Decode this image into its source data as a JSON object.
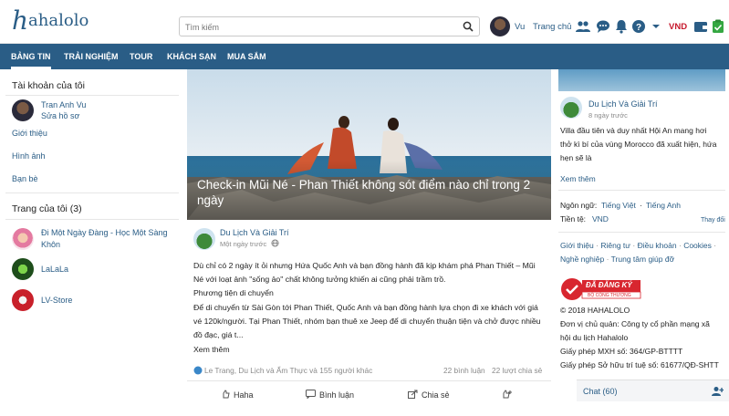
{
  "header": {
    "logo_h": "h",
    "logo_rest": "ahalolo",
    "search_placeholder": "Tìm kiếm",
    "user_name": "Vu",
    "home_label": "Trang chủ",
    "currency": "VND",
    "icons": [
      "search-icon",
      "friends-icon",
      "messages-icon",
      "notifications-icon",
      "help-icon",
      "chevron-down-icon",
      "wallet-icon",
      "clipboard-icon"
    ]
  },
  "nav": {
    "items": [
      "BẢNG TIN",
      "TRẢI NGHIỆM",
      "TOUR",
      "KHÁCH SẠN",
      "MUA SẮM"
    ],
    "active_index": 0
  },
  "left": {
    "account_title": "Tài khoản của tôi",
    "user_name": "Tran Anh Vu",
    "edit_profile": "Sửa hồ sơ",
    "links": [
      "Giới thiệu",
      "Hình ảnh",
      "Bạn bè"
    ],
    "pages_title": "Trang của tôi (3)",
    "pages": [
      {
        "name_line1": "Đi Một Ngày Đàng - Học Một Sàng",
        "name_line2": "Khôn"
      },
      {
        "name_line1": "LaLaLa",
        "name_line2": ""
      },
      {
        "name_line1": "LV-Store",
        "name_line2": ""
      }
    ]
  },
  "feed": {
    "hero_title": "Check-in Mũi Né - Phan Thiết không sót điểm nào chỉ trong 2 ngày",
    "author": "Du Lịch Và Giải Trí",
    "time": "Một ngày trước",
    "text_lines": [
      "Dù chỉ có 2 ngày ít ỏi nhưng Hứa Quốc Anh và bạn đồng hành đã kịp khám phá Phan Thiết – Mũi",
      "Né với loạt ảnh \"sống ảo\" chất không tưởng khiến ai cũng phải trầm trồ.",
      "Phương tiện di chuyển",
      "Để di chuyển từ Sài Gòn tới Phan Thiết, Quốc Anh và bạn đồng hành lựa chọn đi xe khách với giá",
      "vé 120k/người. Tại Phan Thiết, nhóm bạn thuê xe Jeep để di chuyển thuận tiện và chở được nhiều",
      "đồ đạc, giá t..."
    ],
    "see_more": "Xem thêm",
    "reactions": "Le Trang, Du Lịch và Ẩm Thực và 155 người khác",
    "comments_count": "22 bình luận",
    "shares_count": "22 lượt chia sẻ",
    "actions": [
      "Haha",
      "Bình luận",
      "Chia sẻ"
    ]
  },
  "right": {
    "author": "Du Lịch Và Giải Trí",
    "time": "8 ngày trước",
    "desc_lines": [
      "Villa đầu tiên và duy nhất Hội An mang hơi",
      "thở kì bí của vùng Morocco đã xuất hiện, hứa",
      "hẹn sẽ là"
    ],
    "see_more": "Xem thêm",
    "language_label": "Ngôn ngữ:",
    "lang1": "Tiếng Việt",
    "lang_sep": "·",
    "lang2": "Tiếng Anh",
    "currency_label": "Tiền tệ:",
    "currency_value": "VND",
    "change_label": "Thay đổi",
    "footer_links_line1": [
      "Giới thiệu",
      "Riêng tư",
      "Điều khoản",
      "Cookies"
    ],
    "footer_links_line2": [
      "Nghề nghiệp",
      "Trung tâm giúp đỡ"
    ],
    "badge_title": "ĐÃ ĐĂNG KÝ",
    "badge_sub": "BỘ CÔNG THƯƠNG",
    "legal_lines": [
      "© 2018 HAHALOLO",
      "Đơn vị chủ quản: Công ty cổ phần mạng xã",
      "hội du lịch Hahalolo",
      "Giấy phép MXH số: 364/GP-BTTTT",
      "Giấy phép Sở hữu trí tuệ số: 61677/QĐ-SHTT"
    ],
    "chat_label": "Chat (60)"
  },
  "colors": {
    "brand": "#2a5d86",
    "currency": "#c6172b",
    "badge": "#d8262f"
  }
}
